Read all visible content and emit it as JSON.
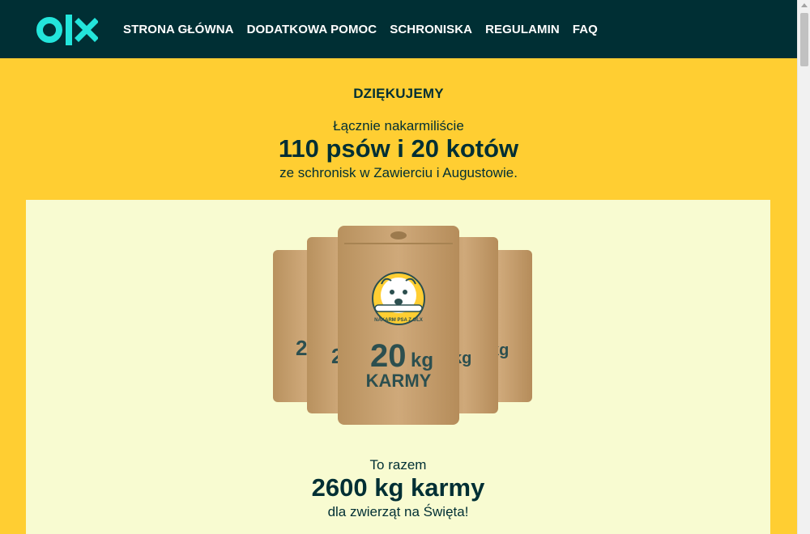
{
  "navbar": {
    "logo_text": "olx",
    "links": [
      {
        "label": "STRONA GŁÓWNA"
      },
      {
        "label": "DODATKOWA POMOC"
      },
      {
        "label": "SCHRONISKA"
      },
      {
        "label": "REGULAMIN"
      },
      {
        "label": "FAQ"
      }
    ]
  },
  "hero": {
    "heading": "DZIĘKUJEMY",
    "intro": "Łącznie nakarmiliście",
    "count": "110 psów i 20 kotów",
    "source": "ze schronisk w Zawierciu i Augustowie."
  },
  "product": {
    "bag_weight": "20",
    "bag_unit": "kg",
    "bag_label": "KARMY",
    "badge_text": "NAKARM PSA Z OLX"
  },
  "summary": {
    "intro": "To razem",
    "amount": "2600 kg karmy",
    "note": "dla zwierząt na Święta!"
  },
  "colors": {
    "navbar_bg": "#002f34",
    "page_bg": "#ffce32",
    "panel_bg": "#f8fbd1",
    "logo_accent": "#23e5db",
    "text_dark": "#002f34"
  }
}
